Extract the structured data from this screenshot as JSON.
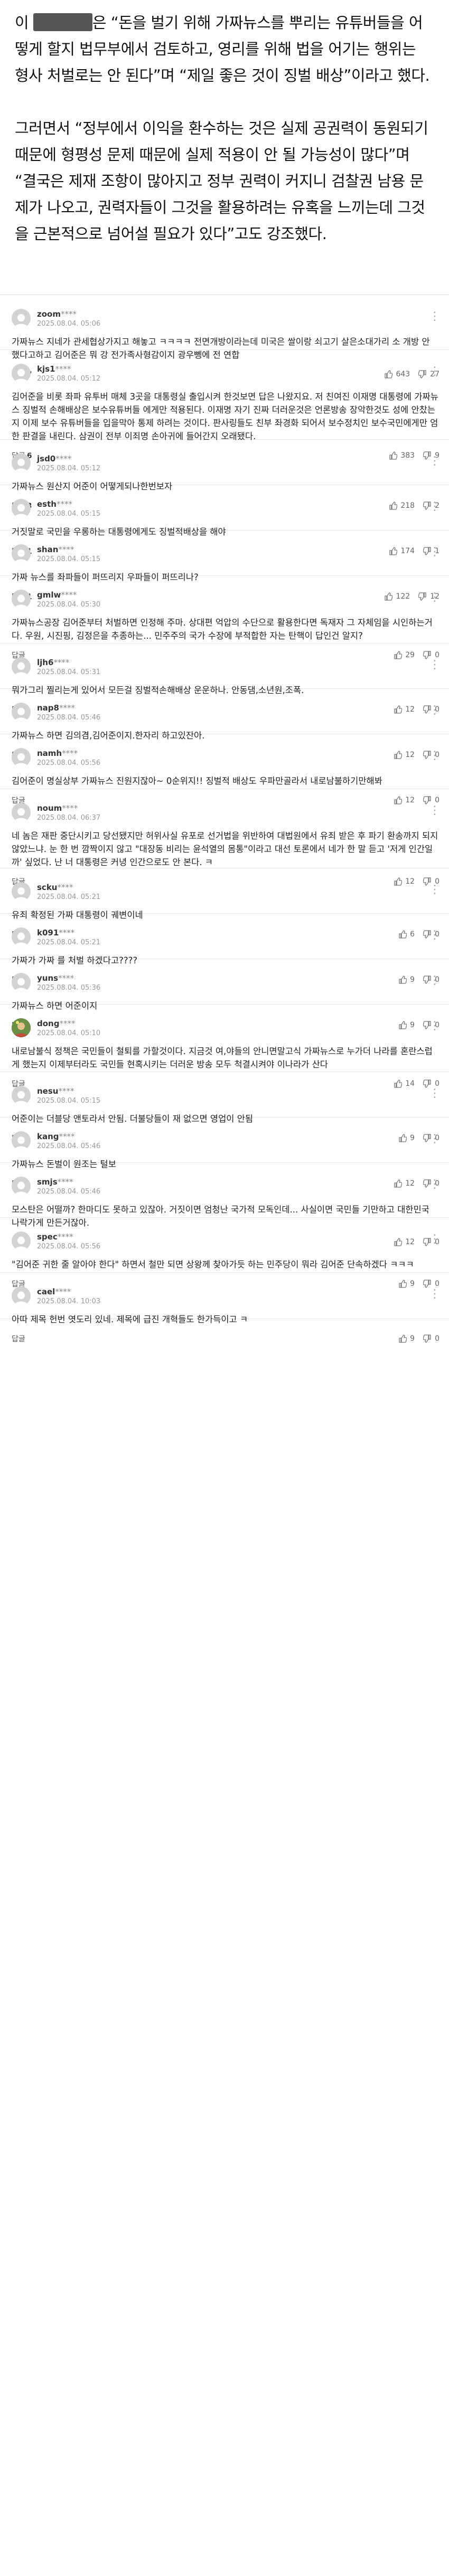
{
  "article": {
    "p1_prefix": "이 ",
    "p1_rest": "은 “돈을 벌기 위해 가짜뉴스를 뿌리는 유튜버들을 어떻게 할지 법무부에서 검토하고, 영리를 위해 법을 어기는 행위는 형사 처벌로는 안 된다”며 “제일 좋은 것이 징벌 배상”이라고 했다.",
    "p2": "그러면서 “정부에서 이익을 환수하는 것은 실제 공권력이 동원되기 때문에 형평성 문제 때문에 실제 적용이 안 될 가능성이 많다”며 “결국은 제재 조항이 많아지고 정부 권력이 커지니 검찰권 남용 문제가 나오고, 권력자들이 그것을 활용하려는 유혹을 느끼는데 그것을 근본적으로 넘어설 필요가 있다”고도 강조했다."
  },
  "comments": [
    {
      "nick": "zoom",
      "stars": "****",
      "date": "2025.08.04. 05:06",
      "text": "가짜뉴스 지네가 관세협상가지고 해놓고 ㅋㅋㅋㅋ 전면개방이라는데 미국은 쌀이랑 쇠고기 살은소대가리 소 개방 안 했다고하고 김어준은 뭐 강 전가족사형감이지 광우뼁에 전 연합",
      "replies_label": "답글",
      "replies": "7",
      "up": "643",
      "down": "27"
    },
    {
      "nick": "kjs1",
      "stars": "****",
      "date": "2025.08.04. 05:12",
      "text": "김어준을 비롯 좌파 유투버 매체 3곳을 대통령실 출입시켜 한것보면 답은 나왔지요. 저 친여진 이재명 대통령에 가짜뉴스 징벌적 손해배상은 보수유튜버들 에게만 적용된다. 이재명 자기 진짜 더러운것은 언론방송 장악한것도 성에 안찼는지 이제 보수 유튜버들을 입을막아 통제 하려는 것이다. 판사링들도 친부 좌경화 되어서 보수정치인 보수국민에게만 엄한 판결을 내린다. 삼권이 전부 이죄명 손아귀에 들어간지 오래됐다.",
      "replies_label": "답글",
      "replies": "6",
      "up": "383",
      "down": "9"
    },
    {
      "nick": "jsd0",
      "stars": "****",
      "date": "2025.08.04. 05:12",
      "text": "가짜뉴스 원산지 어준이 어떻게되나한번보자",
      "replies_label": "답글",
      "replies": "3",
      "up": "218",
      "down": "2"
    },
    {
      "nick": "esth",
      "stars": "****",
      "date": "2025.08.04. 05:15",
      "text": "거짓말로 국민을 우롱하는 대통령에게도 징벌적배상을 해야",
      "replies_label": "답글",
      "replies": "1",
      "up": "174",
      "down": "1"
    },
    {
      "nick": "shan",
      "stars": "****",
      "date": "2025.08.04. 05:15",
      "text": "가짜 뉴스를 좌파들이 퍼뜨리지 우파들이 퍼뜨리나?",
      "replies_label": "답글",
      "replies": "1",
      "up": "122",
      "down": "12"
    },
    {
      "nick": "gmlw",
      "stars": "****",
      "date": "2025.08.04. 05:30",
      "text": "가짜뉴스공장 김어준부터 처벌하면 인정해 주마. 상대편 억압의 수단으로 활용한다면 독재자 그 자체임을 시인하는거다. 우원, 시진핑, 김정은을 추종하는... 민주주의 국가 수장에 부적합한 자는 탄핵이 답인건 알지?",
      "replies_label": "답글",
      "replies": "",
      "up": "29",
      "down": "0"
    },
    {
      "nick": "ljh6",
      "stars": "****",
      "date": "2025.08.04. 05:31",
      "text": "뭐가그리 찔리는게 있어서 모든걸 징벌적손해배상 운운하나. 안동댐,소년원,조폭.",
      "replies_label": "답글",
      "replies": "",
      "up": "12",
      "down": "0"
    },
    {
      "nick": "nap8",
      "stars": "****",
      "date": "2025.08.04. 05:46",
      "text": "가짜뉴스 하면 김의겸,김어준이지.한자리 하고있잔아.",
      "replies_label": "답글",
      "replies": "",
      "up": "12",
      "down": "0"
    },
    {
      "nick": "namh",
      "stars": "****",
      "date": "2025.08.04. 05:56",
      "text": "김어준이 명실상부 가짜뉴스 진원지잖아~ 0순위지!! 징벌적 배상도 우파만골라서 내로남불하기만해봐",
      "replies_label": "답글",
      "replies": "",
      "up": "12",
      "down": "0"
    },
    {
      "nick": "noum",
      "stars": "****",
      "date": "2025.08.04. 06:37",
      "text": "네 놈은 재판 중단시키고 당선됐지만 허위사실 유포로 선거법을 위반하여 대법원에서 유죄 받은 후 파기 환송까지 되지 않았느냐. 눈 한 번 깜짝이지 않고 \"대장동 비리는 윤석열의 몸통\"이라고 대선 토론에서 네가 한 말 듣고 '저게 인간일까' 싶었다. 난 너 대통령은 커녕 인간으로도 안 본다. ㅋ",
      "replies_label": "답글",
      "replies": "",
      "up": "12",
      "down": "0"
    },
    {
      "nick": "scku",
      "stars": "****",
      "date": "2025.08.04. 05:21",
      "text": "유죄 확정된 가짜 대통령이 궤변이네",
      "replies_label": "답글",
      "replies": "",
      "up": "6",
      "down": "0"
    },
    {
      "nick": "k091",
      "stars": "****",
      "date": "2025.08.04. 05:21",
      "text": "가짜가 가짜 를 처벌 하겠다고????",
      "replies_label": "답글",
      "replies": "",
      "up": "9",
      "down": "0"
    },
    {
      "nick": "yuns",
      "stars": "****",
      "date": "2025.08.04. 05:36",
      "text": "가짜뉴스 하면 어준이지",
      "replies_label": "답글",
      "replies": "",
      "up": "9",
      "down": "0"
    },
    {
      "nick": "dong",
      "stars": "****",
      "date": "2025.08.04. 05:10",
      "text": "내로남불식 정책은 국민들이 철퇴를 가할것이다. 지금것 여,야들의 안니면말고식 가짜뉴스로 누가더 나라를 혼란스럽게 했는지 이제부터라도 국민들 현혹시키는 더러운 방송 모두 척결시켜야 이나라가 산다",
      "replies_label": "답글",
      "replies": "",
      "up": "14",
      "down": "0",
      "photo": true
    },
    {
      "nick": "nesu",
      "stars": "****",
      "date": "2025.08.04. 05:15",
      "text": "어준이는 더블당 앤토라서 안됨. 더불당들이 재 없으면 영업이 안됨",
      "replies_label": "답글",
      "replies": "",
      "up": "9",
      "down": "0"
    },
    {
      "nick": "kang",
      "stars": "****",
      "date": "2025.08.04. 05:46",
      "text": "가짜뉴스 돈벌이 원조는 털보",
      "replies_label": "답글",
      "replies": "",
      "up": "12",
      "down": "0"
    },
    {
      "nick": "smjs",
      "stars": "****",
      "date": "2025.08.04. 05:46",
      "text": "모스탄은 어떨까? 한마디도 못하고 있잖아. 거짓이면 엄청난 국가적 모독인데... 사실이면 국민들 기만하고 대한민국 나락가게 만든거잖아.",
      "replies_label": "답글",
      "replies": "",
      "up": "12",
      "down": "0"
    },
    {
      "nick": "spec",
      "stars": "****",
      "date": "2025.08.04. 05:56",
      "text": "\"김어준 귀한 줄 알아야 한다\" 하면서 철만 되면 상왕께 찾아가듯 하는 민주당이 뭐라 김어준 단속하겠다 ㅋㅋㅋ",
      "replies_label": "답글",
      "replies": "",
      "up": "9",
      "down": "0"
    },
    {
      "nick": "cael",
      "stars": "****",
      "date": "2025.08.04. 10:03",
      "text": "아따 제목 헌번 엿도리 있네. 제목에 급진 개혁들도 한가득이고 ㅋ",
      "replies_label": "답글",
      "replies": "",
      "up": "9",
      "down": "0"
    }
  ]
}
